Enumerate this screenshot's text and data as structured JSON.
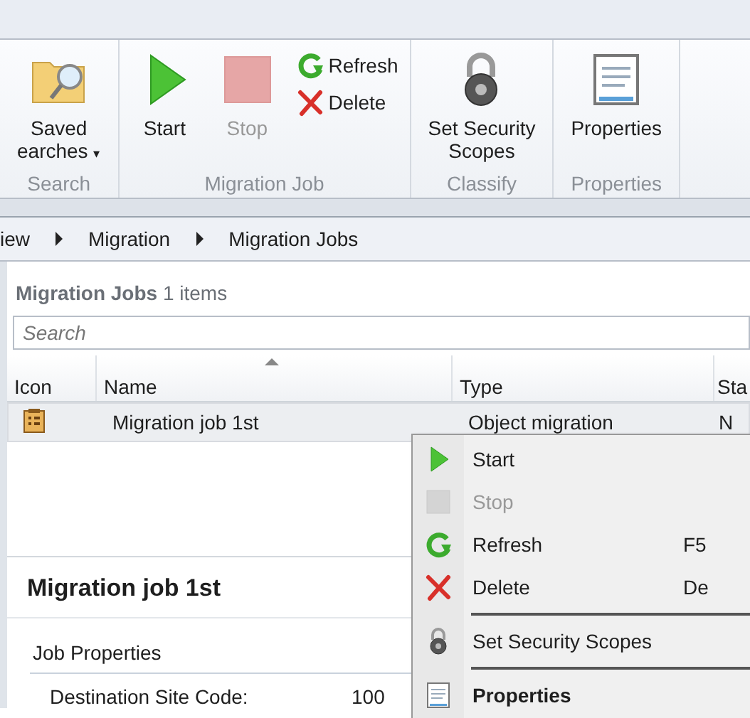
{
  "ribbon": {
    "groups": [
      {
        "label": "Search",
        "large": [
          {
            "kind": "folder-search",
            "label": [
              "Saved",
              "earches"
            ],
            "caret": "▾",
            "disabled": false
          }
        ]
      },
      {
        "label": "Migration Job",
        "large": [
          {
            "kind": "play",
            "label": [
              "Start"
            ],
            "disabled": false
          },
          {
            "kind": "stop",
            "label": [
              "Stop"
            ],
            "disabled": true
          }
        ],
        "small": [
          {
            "kind": "refresh",
            "label": "Refresh",
            "disabled": false
          },
          {
            "kind": "delete",
            "label": "Delete",
            "disabled": false
          }
        ]
      },
      {
        "label": "Classify",
        "large": [
          {
            "kind": "lock",
            "label": [
              "Set Security",
              "Scopes"
            ],
            "disabled": false
          }
        ]
      },
      {
        "label": "Properties",
        "large": [
          {
            "kind": "properties",
            "label": [
              "Properties"
            ],
            "disabled": false
          }
        ]
      }
    ]
  },
  "breadcrumb": [
    "iew",
    "Migration",
    "Migration Jobs"
  ],
  "list": {
    "title": "Migration Jobs",
    "count": "1 items",
    "search": {
      "placeholder": "Search"
    },
    "columns": [
      "Icon",
      "Name",
      "Type",
      "Sta"
    ],
    "rows": [
      {
        "name": "Migration job 1st",
        "type": "Object migration",
        "status": "N",
        "selected": true
      }
    ]
  },
  "details": {
    "title": "Migration job 1st",
    "section": "Job Properties",
    "fields": [
      {
        "label": "Destination Site Code:",
        "value": "100"
      }
    ]
  },
  "context_menu": [
    {
      "kind": "play",
      "label": "Start",
      "disabled": false,
      "default": false
    },
    {
      "kind": "stop",
      "label": "Stop",
      "disabled": true,
      "default": false
    },
    {
      "kind": "refresh",
      "label": "Refresh",
      "shortcut": "F5",
      "disabled": false,
      "default": false
    },
    {
      "kind": "delete",
      "label": "Delete",
      "shortcut": "De",
      "disabled": false,
      "default": false
    },
    {
      "kind": "separator"
    },
    {
      "kind": "lock",
      "label": "Set Security Scopes",
      "disabled": false,
      "default": false
    },
    {
      "kind": "separator"
    },
    {
      "kind": "properties",
      "label": "Properties",
      "disabled": false,
      "default": true
    }
  ]
}
